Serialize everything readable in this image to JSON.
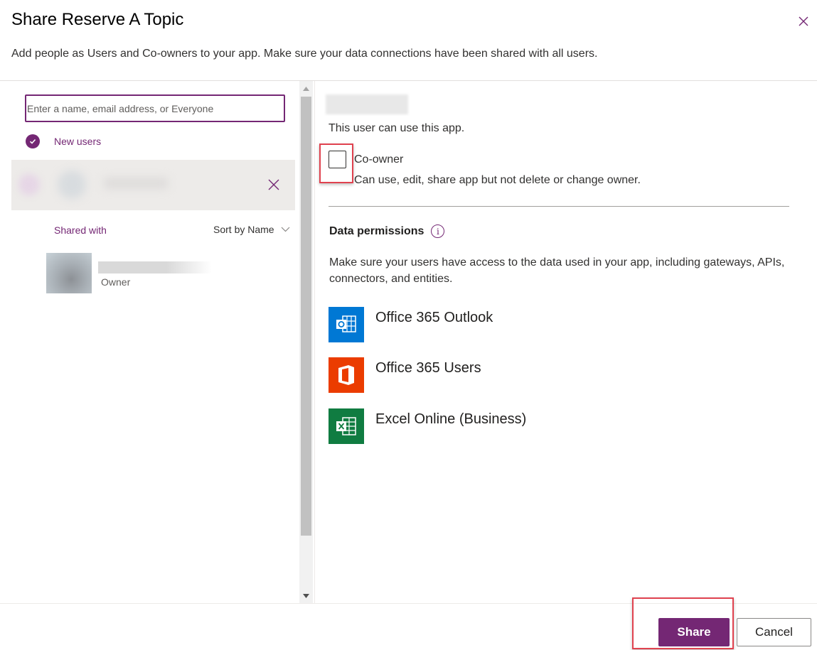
{
  "dialog": {
    "title": "Share Reserve A Topic",
    "subtitle": "Add people as Users and Co-owners to your app. Make sure your data connections have been shared with all users."
  },
  "left_panel": {
    "search": {
      "value": "",
      "placeholder": "Enter a name, email address, or Everyone"
    },
    "new_users_label": "New users",
    "shared_with_label": "Shared with",
    "sort_label": "Sort by Name",
    "owner": {
      "role": "Owner"
    }
  },
  "right_panel": {
    "can_use_text": "This user can use this app.",
    "coowner": {
      "label": "Co-owner",
      "description": "Can use, edit, share app but not delete or change owner.",
      "checked": false
    },
    "data_permissions": {
      "title": "Data permissions",
      "info_glyph": "i",
      "description": "Make sure your users have access to the data used in your app, including gateways, APIs, connectors, and entities."
    },
    "connectors": [
      {
        "label": "Office 365 Outlook",
        "icon": "outlook-icon",
        "color": "#0078d4"
      },
      {
        "label": "Office 365 Users",
        "icon": "office-icon",
        "color": "#eb3c00"
      },
      {
        "label": "Excel Online (Business)",
        "icon": "excel-icon",
        "color": "#107c41"
      }
    ]
  },
  "footer": {
    "share_label": "Share",
    "cancel_label": "Cancel"
  },
  "colors": {
    "accent": "#742774",
    "highlight": "#e0424f"
  }
}
